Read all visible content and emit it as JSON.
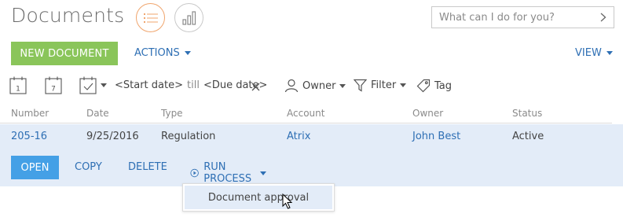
{
  "header": {
    "title": "Documents",
    "list_view_icon": "list-icon",
    "chart_view_icon": "bar-chart-icon",
    "search_placeholder": "What can I do for you?",
    "search_arrow_icon": "chevron-right-icon"
  },
  "toolbar": {
    "new_label": "NEW DOCUMENT",
    "actions_label": "ACTIONS",
    "view_label": "VIEW"
  },
  "filters": {
    "cal_day_1": "1",
    "cal_day_7": "7",
    "start_date": "<Start date>",
    "till": "till",
    "due_date": "<Due date>",
    "owner_label": "Owner",
    "filter_label": "Filter",
    "tag_label": "Tag"
  },
  "table": {
    "columns": [
      "Number",
      "Date",
      "Type",
      "Account",
      "Owner",
      "Status"
    ],
    "rows": [
      {
        "number": "205-16",
        "date": "9/25/2016",
        "type": "Regulation",
        "account": "Atrix",
        "owner": "John Best",
        "status": "Active"
      }
    ]
  },
  "row_actions": {
    "open": "OPEN",
    "copy": "COPY",
    "delete": "DELETE",
    "run_process": "RUN PROCESS"
  },
  "process_menu": {
    "items": [
      "Document approval"
    ]
  },
  "colors": {
    "accent_blue": "#2e6fb4",
    "new_button_green": "#8ac55a",
    "open_button_blue": "#44a0e6",
    "selected_row_bg": "#e3ecf8",
    "list_icon_orange": "#f0a56d"
  }
}
